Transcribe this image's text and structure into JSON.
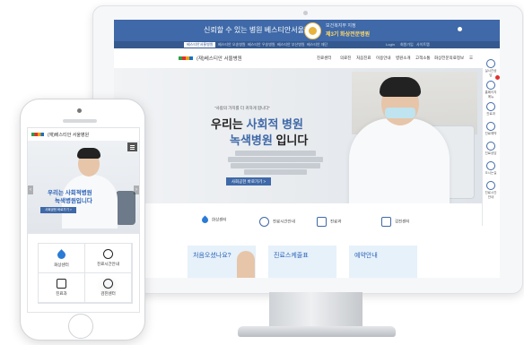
{
  "desktop": {
    "top_bar": {
      "title": "신뢰할 수 있는 병원 베스티안서울병원",
      "badge_sub": "보건복지부 지정",
      "badge_main": "제3기 화상전문병원"
    },
    "util_bar": {
      "active": "베스티안서울병원",
      "links": [
        "베스티안 오송병원",
        "베스티안 우송병원",
        "베스티안 부산병원",
        "베스티안 재단"
      ],
      "right": [
        "Login",
        "회원가입",
        "사이트맵"
      ]
    },
    "nav": {
      "logo": "(재)베스티안 서울병원",
      "menu": [
        "진료센터",
        "의료진",
        "처음진료",
        "이용안내",
        "병원소개",
        "고객소통",
        "화상전문의료정보",
        "☰"
      ]
    },
    "hero": {
      "quote": "\"사람의 가치를 더 귀하게 합니다\"",
      "line1_a": "우리는 ",
      "line1_b": "사회적 병원",
      "line2_a": "녹색병원",
      "line2_b": " 입니다",
      "button": "사회공헌 바로가기 >"
    },
    "quick_links": [
      "화상센터",
      "진료시간안내",
      "진료과",
      "검진센터"
    ],
    "cards": [
      "처음오셨나요?",
      "진료스케줄표",
      "예약안내"
    ],
    "side_menu": [
      "실시간상담",
      "홈페이지 메뉴",
      "진료과",
      "진료예약",
      "진료상담",
      "오시는길",
      "진료시간안내"
    ]
  },
  "mobile": {
    "logo": "(재)베스티안 서울병원",
    "hero_line1": "우리는 사회적병원",
    "hero_line2": "녹색병원입니다",
    "button": "사회공헌 바로가기 >",
    "tiles": [
      "화상센터",
      "진료시간안내",
      "진료과",
      "검진센터"
    ]
  }
}
